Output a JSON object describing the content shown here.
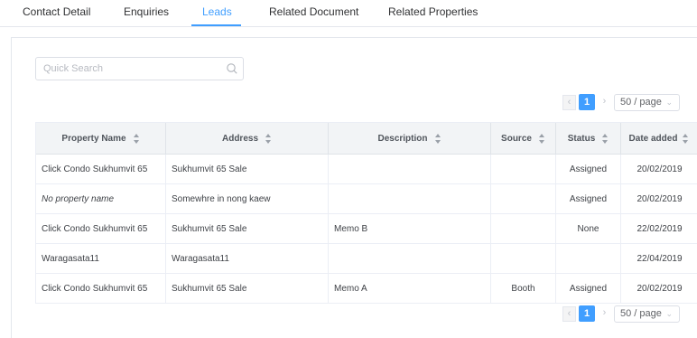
{
  "tabs": [
    {
      "label": "Contact Detail",
      "active": false
    },
    {
      "label": "Enquiries",
      "active": false
    },
    {
      "label": "Leads",
      "active": true
    },
    {
      "label": "Related Document",
      "active": false
    },
    {
      "label": "Related Properties",
      "active": false
    }
  ],
  "search": {
    "placeholder": "Quick Search",
    "value": "",
    "icon": "search-icon"
  },
  "pagination": {
    "current_page": "1",
    "page_size": "50 / page",
    "prev_icon": "chevron-left-icon",
    "next_icon": "chevron-right-icon",
    "dropdown_icon": "chevron-down-icon"
  },
  "table": {
    "columns": [
      "Property Name",
      "Address",
      "Description",
      "Source",
      "Status",
      "Date added"
    ],
    "rows": [
      [
        "Click Condo Sukhumvit 65",
        "Sukhumvit 65 Sale",
        "",
        "",
        "Assigned",
        "20/02/2019"
      ],
      [
        "No property name",
        "Somewhre in nong kaew",
        "",
        "",
        "Assigned",
        "20/02/2019"
      ],
      [
        "Click Condo Sukhumvit 65",
        "Sukhumvit 65 Sale",
        "Memo B",
        "",
        "None",
        "22/02/2019"
      ],
      [
        "Waragasata11",
        "Waragasata11",
        "",
        "",
        "",
        "22/04/2019"
      ],
      [
        "Click Condo Sukhumvit 65",
        "Sukhumvit 65 Sale",
        "Memo A",
        "Booth",
        "Assigned",
        "20/02/2019"
      ]
    ]
  },
  "colors": {
    "accent": "#409eff",
    "header_bg": "#f2f4f6",
    "border": "#ebeef5"
  }
}
